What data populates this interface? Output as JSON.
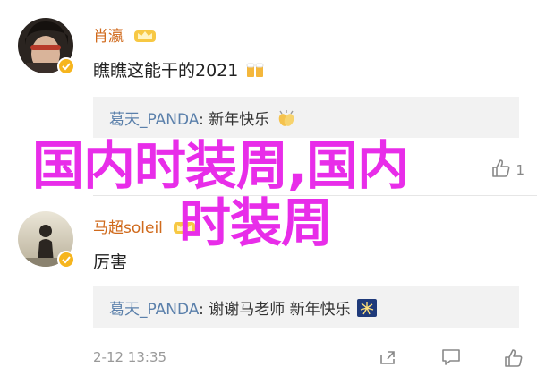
{
  "comments": [
    {
      "name": "肖瀛",
      "name_icon": "crown-icon",
      "text": "瞧瞧这能干的2021",
      "text_emoji": "beer-icon",
      "reply": {
        "name": "葛天_PANDA",
        "separator": ": ",
        "text": "新年快乐",
        "emoji": "clap-icon"
      }
    },
    {
      "name": "马超soleil",
      "name_icon": "crown-icon",
      "text": "厉害",
      "reply": {
        "name": "葛天_PANDA",
        "separator": ": ",
        "text": "谢谢马老师 新年快乐",
        "emoji": "fireworks-icon"
      },
      "timestamp": "2-12 13:35"
    }
  ],
  "overlay": {
    "line1": "国内时装周,国内",
    "line2": "时装周",
    "color": "#e82de9"
  },
  "actions": {
    "share_icon": "share-icon",
    "comment_icon": "comment-icon",
    "like_icon": "thumbs-up-icon",
    "like_label": "1"
  },
  "colors": {
    "name": "#d06a1c",
    "reply_name": "#5b80ab",
    "badge": "#f6b51e"
  }
}
